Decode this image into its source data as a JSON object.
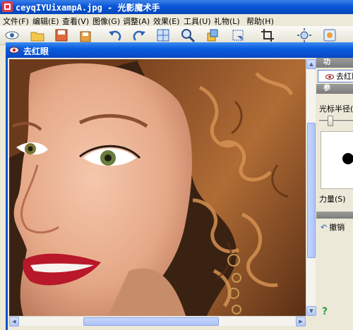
{
  "app": {
    "title": "ceyqIYUixampA.jpg - 光影魔术手"
  },
  "menubar": {
    "items": [
      {
        "label": "文件(F)"
      },
      {
        "label": "编辑(E)"
      },
      {
        "label": "查看(V)"
      },
      {
        "label": "图像(G)"
      },
      {
        "label": "调整(A)"
      },
      {
        "label": "效果(E)"
      },
      {
        "label": "工具(U)"
      },
      {
        "label": "礼物(L)"
      },
      {
        "label": "帮助(H)"
      }
    ]
  },
  "toolbar": {
    "icons": [
      "preview-eye-icon",
      "open-folder-icon",
      "save-icon",
      "save-as-icon",
      "rotate-left-icon",
      "rotate-right-icon",
      "browse-grid-icon",
      "zoom-icon",
      "layers-icon",
      "resize-icon",
      "crop-icon",
      "auto-exposure-icon",
      "image-settings-icon"
    ]
  },
  "dialog": {
    "title": "去红眼",
    "panel": {
      "section_function": "功",
      "function_button": "去红眼",
      "section_params": "参",
      "cursor_radius_label": "光标半径(R)",
      "strength_label": "力量(S)",
      "undo_label": "撤销",
      "help_label": "?"
    }
  },
  "colors": {
    "titlebar": "#0a55d7",
    "dialog_frame": "#0a52d0",
    "panel_bg": "#ece9d8",
    "section_header": "#8c8c8c"
  }
}
